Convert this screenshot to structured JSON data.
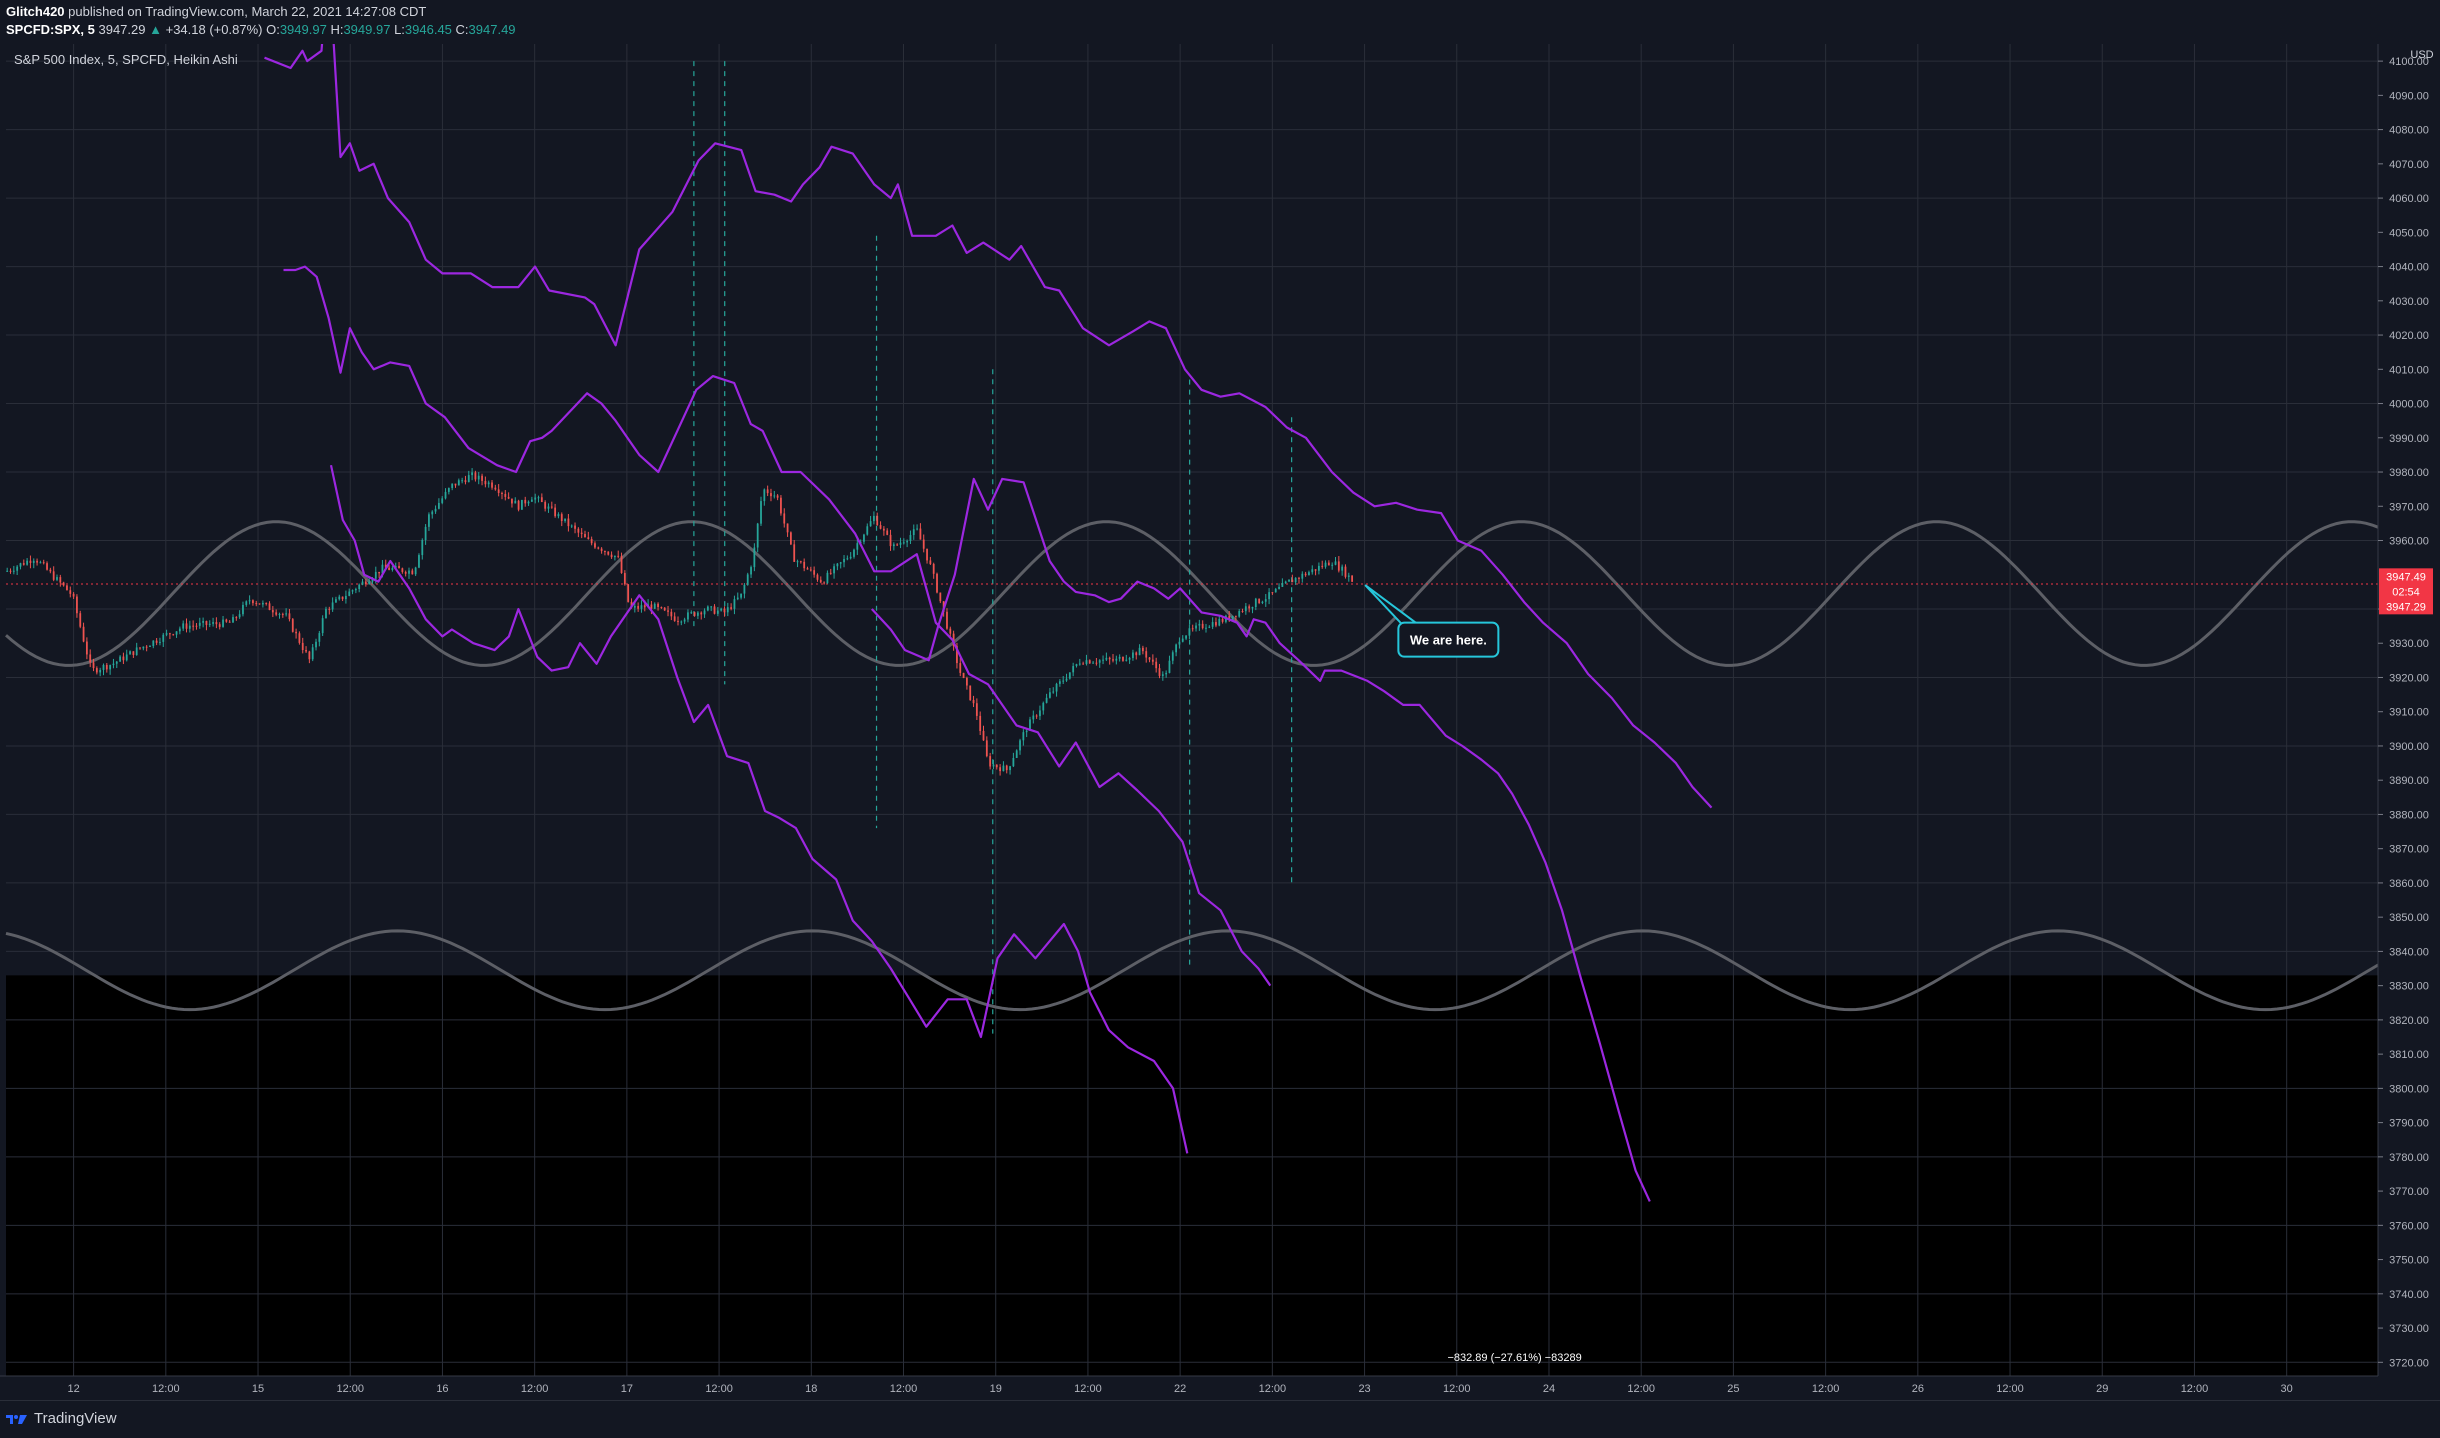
{
  "header": {
    "author": "Glitch420",
    "published_text": "published on TradingView.com, March 22, 2021 14:27:08 CDT",
    "symbol": "SPCFD:SPX, 5",
    "last": "3947.29",
    "change": "+34.18 (+0.87%)",
    "o_label": "O:",
    "o": "3949.97",
    "h_label": "H:",
    "h": "3949.97",
    "l_label": "L:",
    "l": "3946.45",
    "c_label": "C:",
    "c": "3947.49"
  },
  "colors": {
    "background": "#131722",
    "lower_band": "#000000",
    "projection": "#9c27e0",
    "sine": "#5d5f66",
    "up_candle": "#26a69a",
    "down_candle": "#ef5350",
    "callout": "#26c6da",
    "price_tag": "#f23645"
  },
  "footer": {
    "brand": "TradingView"
  },
  "chart_data": {
    "type": "line",
    "title": "S&P 500 Index, 5, SPCFD, Heikin Ashi",
    "currency": "USD",
    "y_ticks": [
      4100,
      4090,
      4080,
      4070,
      4060,
      4050,
      4040,
      4030,
      4020,
      4010,
      4000,
      3990,
      3980,
      3970,
      3960,
      3950,
      3940,
      3930,
      3920,
      3910,
      3900,
      3890,
      3880,
      3870,
      3860,
      3850,
      3840,
      3830,
      3820,
      3810,
      3800,
      3790,
      3780,
      3770,
      3760,
      3750,
      3740,
      3730,
      3720
    ],
    "y_tick_labels": [
      "4100.00",
      "4090.00",
      "4080.00",
      "4070.00",
      "4060.00",
      "4050.00",
      "4040.00",
      "4030.00",
      "4020.00",
      "4010.00",
      "4000.00",
      "3990.00",
      "3980.00",
      "3970.00",
      "3960.00",
      "",
      "3940.00",
      "3930.00",
      "3920.00",
      "3910.00",
      "3900.00",
      "3890.00",
      "3880.00",
      "3870.00",
      "3860.00",
      "3850.00",
      "3840.00",
      "3830.00",
      "3820.00",
      "3810.00",
      "3800.00",
      "3790.00",
      "3780.00",
      "3770.00",
      "3760.00",
      "3750.00",
      "3740.00",
      "3730.00",
      "3720.00"
    ],
    "ylim": [
      3716,
      4105
    ],
    "x_ticks": [
      "12",
      "12:00",
      "15",
      "12:00",
      "16",
      "12:00",
      "17",
      "12:00",
      "18",
      "12:00",
      "19",
      "12:00",
      "22",
      "12:00",
      "23",
      "12:00",
      "24",
      "12:00",
      "25",
      "12:00",
      "26",
      "12:00",
      "29",
      "12:00",
      "30"
    ],
    "price_labels": {
      "last": "3947.49",
      "countdown": "02:54",
      "close": "3947.29"
    },
    "callout": "We are here.",
    "measure_label": "−832.89 (−27.61%) −83289",
    "series": [
      {
        "values": [
          [
            10.9,
            4101
          ],
          [
            12.0,
            4098
          ],
          [
            12.5,
            4103
          ],
          [
            12.7,
            4100
          ],
          [
            13.3,
            4103
          ],
          [
            13.6,
            4130
          ],
          [
            14.1,
            4072
          ],
          [
            14.5,
            4076
          ],
          [
            14.9,
            4068
          ],
          [
            15.5,
            4070
          ],
          [
            16.1,
            4060
          ],
          [
            17.0,
            4053
          ],
          [
            17.7,
            4042
          ],
          [
            18.4,
            4038
          ],
          [
            19.6,
            4038
          ],
          [
            20.5,
            4034
          ],
          [
            21.6,
            4034
          ],
          [
            22.3,
            4040
          ],
          [
            22.9,
            4033
          ],
          [
            24.4,
            4031
          ],
          [
            24.8,
            4029
          ],
          [
            25.7,
            4017
          ],
          [
            26.7,
            4045
          ],
          [
            28.1,
            4056
          ],
          [
            29.2,
            4071
          ],
          [
            29.9,
            4076
          ],
          [
            31.0,
            4074
          ],
          [
            31.6,
            4062
          ],
          [
            32.4,
            4061
          ],
          [
            33.1,
            4059
          ],
          [
            33.6,
            4064
          ],
          [
            34.3,
            4069
          ],
          [
            34.8,
            4075
          ],
          [
            35.7,
            4073
          ],
          [
            36.6,
            4064
          ],
          [
            37.3,
            4060
          ],
          [
            37.6,
            4064
          ],
          [
            38.2,
            4049
          ],
          [
            39.2,
            4049
          ],
          [
            39.9,
            4052
          ],
          [
            40.5,
            4044
          ],
          [
            41.2,
            4047
          ],
          [
            42.3,
            4042
          ],
          [
            42.8,
            4046
          ],
          [
            43.8,
            4034
          ],
          [
            44.4,
            4033
          ],
          [
            45.4,
            4022
          ],
          [
            46.5,
            4017
          ],
          [
            47.5,
            4021
          ],
          [
            48.2,
            4024
          ],
          [
            48.9,
            4022
          ],
          [
            49.7,
            4010
          ],
          [
            50.4,
            4004
          ],
          [
            51.2,
            4002
          ],
          [
            52.0,
            4003
          ],
          [
            53.1,
            3999
          ],
          [
            54.0,
            3993
          ],
          [
            54.8,
            3990
          ],
          [
            55.9,
            3980
          ],
          [
            56.8,
            3974
          ],
          [
            57.7,
            3970
          ],
          [
            58.6,
            3971
          ],
          [
            59.5,
            3969
          ],
          [
            60.5,
            3968
          ],
          [
            61.2,
            3960
          ],
          [
            62.2,
            3957
          ],
          [
            63.1,
            3950
          ],
          [
            64.0,
            3942
          ],
          [
            64.8,
            3936
          ],
          [
            65.8,
            3930
          ],
          [
            66.7,
            3921
          ],
          [
            67.7,
            3914
          ],
          [
            68.6,
            3906
          ],
          [
            69.5,
            3901
          ],
          [
            70.4,
            3895
          ],
          [
            71.1,
            3888
          ],
          [
            71.9,
            3882
          ]
        ]
      },
      {
        "values": [
          [
            11.7,
            4039
          ],
          [
            12.2,
            4039
          ],
          [
            12.6,
            4040
          ],
          [
            13.1,
            4037
          ],
          [
            13.6,
            4025
          ],
          [
            14.1,
            4009
          ],
          [
            14.5,
            4022
          ],
          [
            15.0,
            4015
          ],
          [
            15.5,
            4010
          ],
          [
            16.2,
            4012
          ],
          [
            17.0,
            4011
          ],
          [
            17.7,
            4000
          ],
          [
            18.5,
            3996
          ],
          [
            19.5,
            3987
          ],
          [
            20.7,
            3982
          ],
          [
            21.5,
            3980
          ],
          [
            22.1,
            3989
          ],
          [
            22.6,
            3990
          ],
          [
            23.0,
            3992
          ],
          [
            24.5,
            4003
          ],
          [
            25.1,
            4000
          ],
          [
            25.7,
            3995
          ],
          [
            26.7,
            3985
          ],
          [
            27.5,
            3980
          ],
          [
            28.3,
            3992
          ],
          [
            29.1,
            4004
          ],
          [
            29.8,
            4008
          ],
          [
            30.7,
            4006
          ],
          [
            31.4,
            3994
          ],
          [
            31.9,
            3992
          ],
          [
            32.7,
            3980
          ],
          [
            33.5,
            3980
          ],
          [
            34.7,
            3972
          ],
          [
            35.8,
            3962
          ],
          [
            36.6,
            3951
          ],
          [
            37.3,
            3951
          ],
          [
            38.4,
            3956
          ],
          [
            39.2,
            3936
          ],
          [
            39.9,
            3931
          ],
          [
            40.6,
            3921
          ],
          [
            41.4,
            3918
          ],
          [
            42.6,
            3906
          ],
          [
            43.5,
            3904
          ],
          [
            44.4,
            3894
          ],
          [
            45.1,
            3901
          ],
          [
            46.1,
            3888
          ],
          [
            46.9,
            3892
          ],
          [
            47.7,
            3887
          ],
          [
            48.6,
            3881
          ],
          [
            49.6,
            3872
          ],
          [
            50.3,
            3857
          ],
          [
            51.2,
            3852
          ],
          [
            52.1,
            3840
          ],
          [
            52.8,
            3835
          ],
          [
            53.3,
            3830
          ]
        ]
      },
      {
        "values": [
          [
            13.7,
            3982
          ],
          [
            14.2,
            3966
          ],
          [
            14.7,
            3960
          ],
          [
            15.1,
            3950
          ],
          [
            15.7,
            3948
          ],
          [
            16.2,
            3954
          ],
          [
            17.0,
            3946
          ],
          [
            17.7,
            3937
          ],
          [
            18.4,
            3932
          ],
          [
            18.8,
            3934
          ],
          [
            19.7,
            3930
          ],
          [
            20.6,
            3928
          ],
          [
            21.2,
            3932
          ],
          [
            21.6,
            3940
          ],
          [
            22.4,
            3926
          ],
          [
            23.0,
            3922
          ],
          [
            23.7,
            3923
          ],
          [
            24.2,
            3930
          ],
          [
            24.9,
            3924
          ],
          [
            25.5,
            3932
          ],
          [
            26.7,
            3944
          ],
          [
            27.5,
            3937
          ],
          [
            28.3,
            3920
          ],
          [
            29.0,
            3907
          ],
          [
            29.6,
            3912
          ],
          [
            30.4,
            3897
          ],
          [
            31.3,
            3895
          ],
          [
            32.0,
            3881
          ],
          [
            32.6,
            3879
          ],
          [
            33.3,
            3876
          ],
          [
            34.0,
            3867
          ],
          [
            35.0,
            3861
          ],
          [
            35.7,
            3849
          ],
          [
            36.5,
            3843
          ],
          [
            37.3,
            3835
          ],
          [
            38.1,
            3826
          ],
          [
            38.8,
            3818
          ],
          [
            39.7,
            3826
          ],
          [
            40.5,
            3826
          ],
          [
            41.1,
            3815
          ],
          [
            41.8,
            3838
          ],
          [
            42.5,
            3845
          ],
          [
            43.4,
            3838
          ],
          [
            44.0,
            3843
          ],
          [
            44.6,
            3848
          ],
          [
            45.2,
            3840
          ],
          [
            45.7,
            3828
          ],
          [
            46.5,
            3817
          ],
          [
            47.3,
            3812
          ],
          [
            48.4,
            3808
          ],
          [
            49.2,
            3800
          ],
          [
            49.8,
            3781
          ]
        ]
      },
      {
        "values": [
          [
            36.5,
            3940
          ],
          [
            37.3,
            3934
          ],
          [
            37.9,
            3928
          ],
          [
            38.9,
            3925
          ],
          [
            39.3,
            3935
          ],
          [
            40.0,
            3950
          ],
          [
            40.8,
            3978
          ],
          [
            41.4,
            3969
          ],
          [
            42.0,
            3978
          ],
          [
            42.9,
            3977
          ],
          [
            44.0,
            3954
          ],
          [
            44.6,
            3948
          ],
          [
            45.1,
            3945
          ],
          [
            45.9,
            3944
          ],
          [
            46.5,
            3942
          ],
          [
            47.0,
            3943
          ],
          [
            47.7,
            3948
          ],
          [
            48.4,
            3946
          ],
          [
            49.0,
            3943
          ],
          [
            49.5,
            3946
          ],
          [
            50.4,
            3939
          ],
          [
            51.2,
            3938
          ],
          [
            51.9,
            3936
          ],
          [
            52.3,
            3932
          ],
          [
            52.6,
            3937
          ],
          [
            53.1,
            3936
          ],
          [
            53.7,
            3930
          ],
          [
            54.5,
            3925
          ],
          [
            55.4,
            3919
          ],
          [
            55.6,
            3922
          ],
          [
            56.3,
            3922
          ],
          [
            57.4,
            3919
          ],
          [
            58.1,
            3916
          ],
          [
            58.9,
            3912
          ],
          [
            59.6,
            3912
          ],
          [
            60.7,
            3903
          ],
          [
            61.4,
            3900
          ],
          [
            62.2,
            3896
          ],
          [
            62.9,
            3892
          ],
          [
            63.5,
            3886
          ],
          [
            64.2,
            3877
          ],
          [
            64.9,
            3866
          ],
          [
            65.6,
            3852
          ],
          [
            66.4,
            3832
          ],
          [
            67.2,
            3813
          ],
          [
            68.0,
            3793
          ],
          [
            68.7,
            3776
          ],
          [
            69.3,
            3767
          ]
        ]
      }
    ]
  }
}
